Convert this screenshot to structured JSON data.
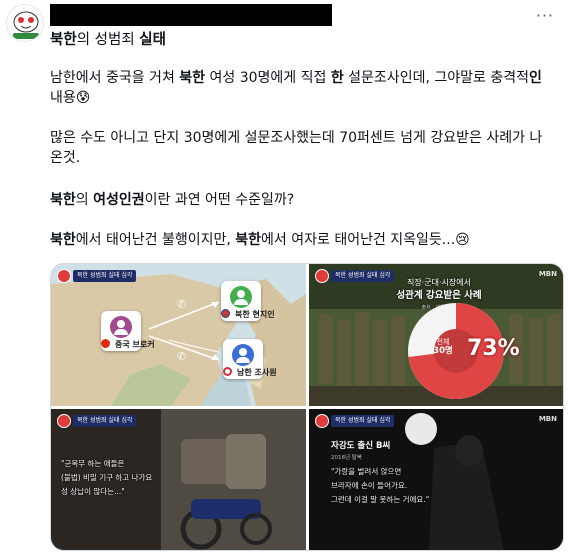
{
  "post": {
    "title_parts": {
      "a": "북한",
      "b": "의 성범죄 ",
      "c": "실태"
    },
    "p1": {
      "a": "남한에서 중국을 거쳐 ",
      "b": "북한",
      "c": " 여성 30명에게 직접 ",
      "d": "한",
      "e": " 설문조사인데, 그야말로 충격적",
      "f": "인",
      "g": "내용",
      "emoji": "😰"
    },
    "p2": {
      "line1": "많은 수도 아니고 단지 30명에게 설문조사했는데 70퍼센트 넘게 강요받은 사례가 나",
      "line2": "온것."
    },
    "p3": {
      "a": "북한",
      "b": "의 ",
      "c": "여성인권",
      "d": "이란 과연 어떤 수준일까?"
    },
    "p4": {
      "a": "북한",
      "b": "에서 태어난건 불행이지만, ",
      "c": "북한",
      "d": "에서 여자로 태어난건 지옥일듯...",
      "emoji": "😢"
    },
    "more_icon": "···"
  },
  "media": {
    "channel_tag": "북한 성범죄 실태 심각",
    "broadcaster": "MBN",
    "tile1": {
      "node_nk": "북한 현지인",
      "node_cn": "중국 브로커",
      "node_sk": "남한 조사원"
    },
    "tile2": {
      "headline1": "직장·군대·시장에서",
      "headline2": "성관계 강요받은 사례",
      "source": "출처 : 데일리NK",
      "center_label1": "전체",
      "center_label2": "30명",
      "percent": "73%",
      "percent_value": 73,
      "colors": {
        "filled": "#e04545",
        "rest": "#f4f4f4"
      }
    },
    "tile3": {
      "quote1": "\"군복무 하는 애들은",
      "quote2": "(불법) 비밀 기구 하고 나가요",
      "quote3": "성 상납이 많다는...\""
    },
    "tile4": {
      "speaker": "자강도 출신 B씨",
      "speaker_sub": "2018년 탈북",
      "quote1": "\"가랑을 벌려서 앉으면",
      "quote2": "브라자에 손이 들어가요.",
      "quote3": "그런데 이걸 말 못하는 거에요.\""
    }
  }
}
